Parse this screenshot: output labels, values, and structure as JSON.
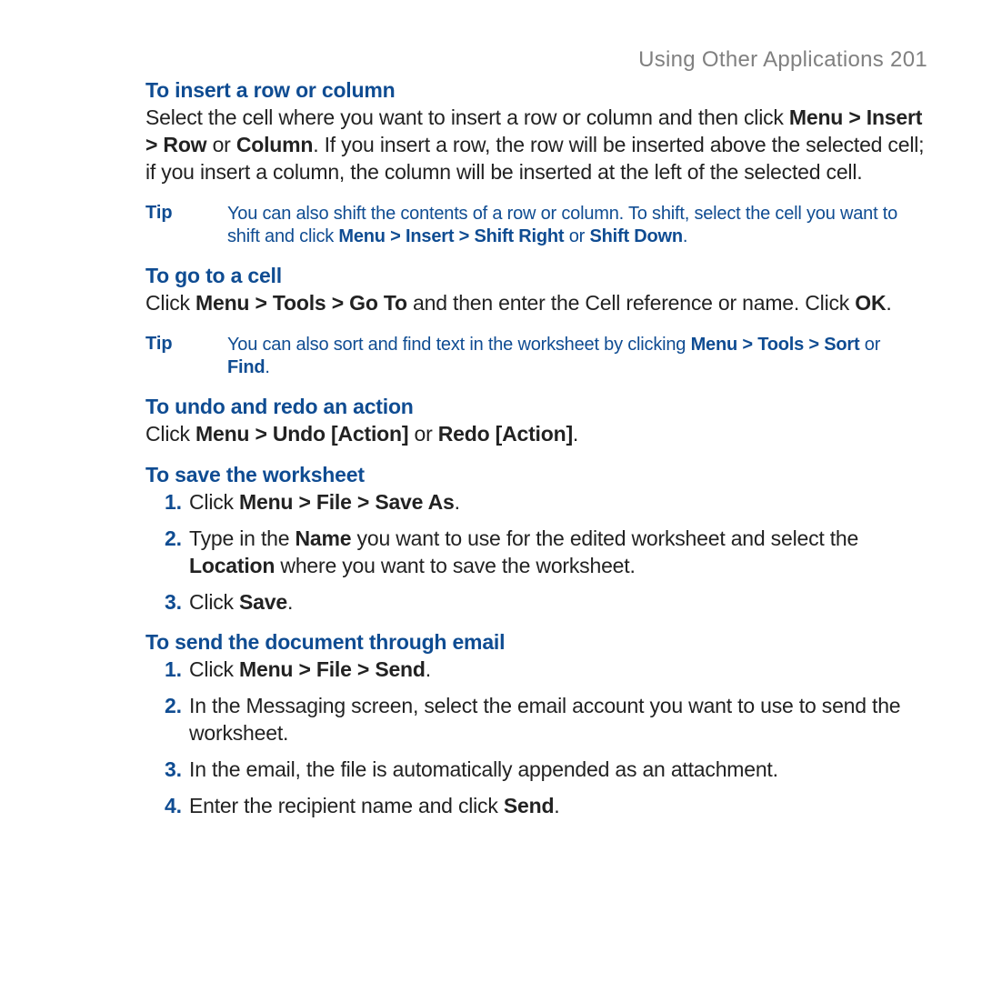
{
  "header": {
    "running_head": "Using Other Applications  201"
  },
  "s1": {
    "title": "To insert a row or column",
    "p_a": "Select the cell where you want to insert a row or column and then click ",
    "p_b": "Menu > Insert > Row",
    "p_c": " or ",
    "p_d": "Column",
    "p_e": ". If you insert a row, the row will be inserted above the selected cell; if you insert a column, the column will be inserted at the left of the selected cell.",
    "tip_label": "Tip",
    "tip_a": "You can also shift the contents of a row or column. To shift, select the cell you want to shift and click ",
    "tip_b": "Menu > Insert > Shift Right",
    "tip_c": " or ",
    "tip_d": "Shift Down",
    "tip_e": "."
  },
  "s2": {
    "title": "To go to a cell",
    "p_a": "Click ",
    "p_b": "Menu > Tools > Go To",
    "p_c": " and then enter the Cell reference or name. Click ",
    "p_d": "OK",
    "p_e": ".",
    "tip_label": "Tip",
    "tip_a": "You can also sort and find text in the worksheet by clicking ",
    "tip_b": "Menu > Tools > Sort",
    "tip_c": " or ",
    "tip_d": "Find",
    "tip_e": "."
  },
  "s3": {
    "title": "To undo and redo an action",
    "p_a": "Click ",
    "p_b": "Menu > Undo [Action]",
    "p_c": " or ",
    "p_d": "Redo [Action]",
    "p_e": "."
  },
  "s4": {
    "title": "To save the worksheet",
    "step1_a": "Click ",
    "step1_b": "Menu > File > Save As",
    "step1_c": ".",
    "step2_a": "Type in the ",
    "step2_b": "Name",
    "step2_c": " you want to use for the edited worksheet and select the ",
    "step2_d": "Location",
    "step2_e": " where you want to save the worksheet.",
    "step3_a": "Click ",
    "step3_b": "Save",
    "step3_c": "."
  },
  "s5": {
    "title": "To send the document through email",
    "step1_a": "Click ",
    "step1_b": "Menu > File > Send",
    "step1_c": ".",
    "step2": "In the Messaging screen, select the email account you want to use to send the worksheet.",
    "step3": "In the email, the file is automatically appended as an attachment.",
    "step4_a": "Enter the recipient name and click ",
    "step4_b": "Send",
    "step4_c": "."
  }
}
